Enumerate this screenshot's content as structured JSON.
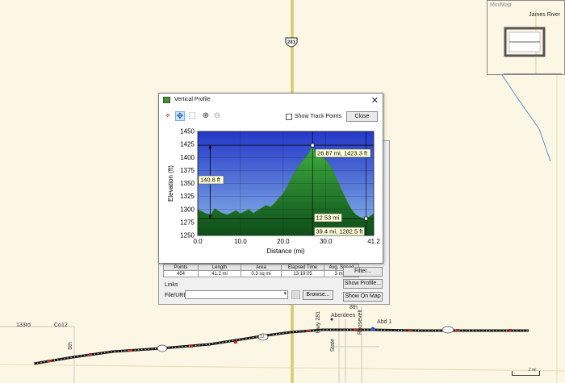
{
  "map": {
    "highway_shield": "281",
    "road_labels": {
      "r133rd": "133rd",
      "co12": "Co12",
      "fifth": "5th",
      "eighth": "8th",
      "aberdeen": "Aberdeen",
      "abd": "Abd 1",
      "state": "State",
      "roosevelt": "Roosevelt",
      "hwy281": "Hwy 281",
      "shield_small": "12"
    },
    "scale_label": "2 mi",
    "colors": {
      "background": "#fbf7e4",
      "roads": "#d8cf9a",
      "track": "#111111",
      "markers": "#cc2222",
      "water": "#5a8fd0"
    }
  },
  "minimap": {
    "title": "MiniMap",
    "place_label": "James River"
  },
  "profile_window": {
    "title": "Vertical Profile",
    "close_x": "✕",
    "show_track_points_label": "Show Track Points",
    "close_button": "Close",
    "tools": [
      "crosshair-icon",
      "move-icon",
      "select-zoom-icon",
      "zoom-in-icon",
      "zoom-out-icon"
    ]
  },
  "chart_data": {
    "type": "area",
    "xlabel": "Distance    (mi)",
    "ylabel": "Elevation (ft)",
    "xlim": [
      0,
      41.2
    ],
    "ylim": [
      1250,
      1450
    ],
    "xticks": [
      0.0,
      10.0,
      20.0,
      30.0,
      41.2
    ],
    "xtick_labels": [
      "0.0",
      "10.0",
      "20.0",
      "30.0",
      "41.2"
    ],
    "yticks": [
      1250,
      1275,
      1300,
      1325,
      1350,
      1375,
      1400,
      1425,
      1450
    ],
    "ytick_labels": [
      "1250",
      "1275",
      "1300",
      "1325",
      "1350",
      "1375",
      "1400",
      "1425",
      "1450"
    ],
    "grid": true,
    "colors": {
      "sky_top": "#2438c8",
      "sky_bottom": "#8ab8e8",
      "ground_top": "#3fae3f",
      "ground_bottom": "#0e4f1a"
    },
    "series": [
      {
        "x": [
          0,
          1,
          2,
          3,
          4,
          5,
          6,
          7,
          8,
          9,
          10,
          11,
          12,
          13,
          14,
          15,
          16,
          17,
          18,
          19,
          20,
          21,
          22,
          23,
          24,
          25,
          26,
          26.87,
          27.5,
          28,
          29,
          30,
          31,
          32,
          33,
          34,
          35,
          36,
          37,
          38,
          39,
          39.4,
          40,
          41.2
        ],
        "y": [
          1300,
          1296,
          1292,
          1290,
          1302,
          1296,
          1292,
          1290,
          1294,
          1298,
          1292,
          1296,
          1300,
          1293,
          1298,
          1303,
          1308,
          1305,
          1312,
          1322,
          1330,
          1345,
          1362,
          1375,
          1388,
          1398,
          1408,
          1423.3,
          1410,
          1402,
          1400,
          1395,
          1385,
          1368,
          1350,
          1332,
          1315,
          1300,
          1290,
          1285,
          1282,
          1282.5,
          1285,
          1292
        ]
      }
    ],
    "annotations": {
      "elevation_gain_label": "140.8 ft",
      "peak_label": "26.87 mi, 1423.3 ft",
      "distance_span_label": "12.53 mi",
      "low_point_label": "39.4 mi, 1282.5 ft"
    }
  },
  "stats": {
    "headers": [
      "Points",
      "Length",
      "Area",
      "Elapsed Time",
      "Avg. Speed"
    ],
    "values": [
      "454",
      "41.2 mi",
      "0.3 sq mi",
      "13:19:05",
      "3 mph"
    ]
  },
  "links": {
    "section_label": "Links",
    "file_url_label": "File/URL:",
    "file_url_value": "",
    "browse_button": "Browse..."
  },
  "side_buttons": {
    "filter": "Filter...",
    "show_profile": "Show Profile...",
    "show_on_map": "Show On Map"
  }
}
